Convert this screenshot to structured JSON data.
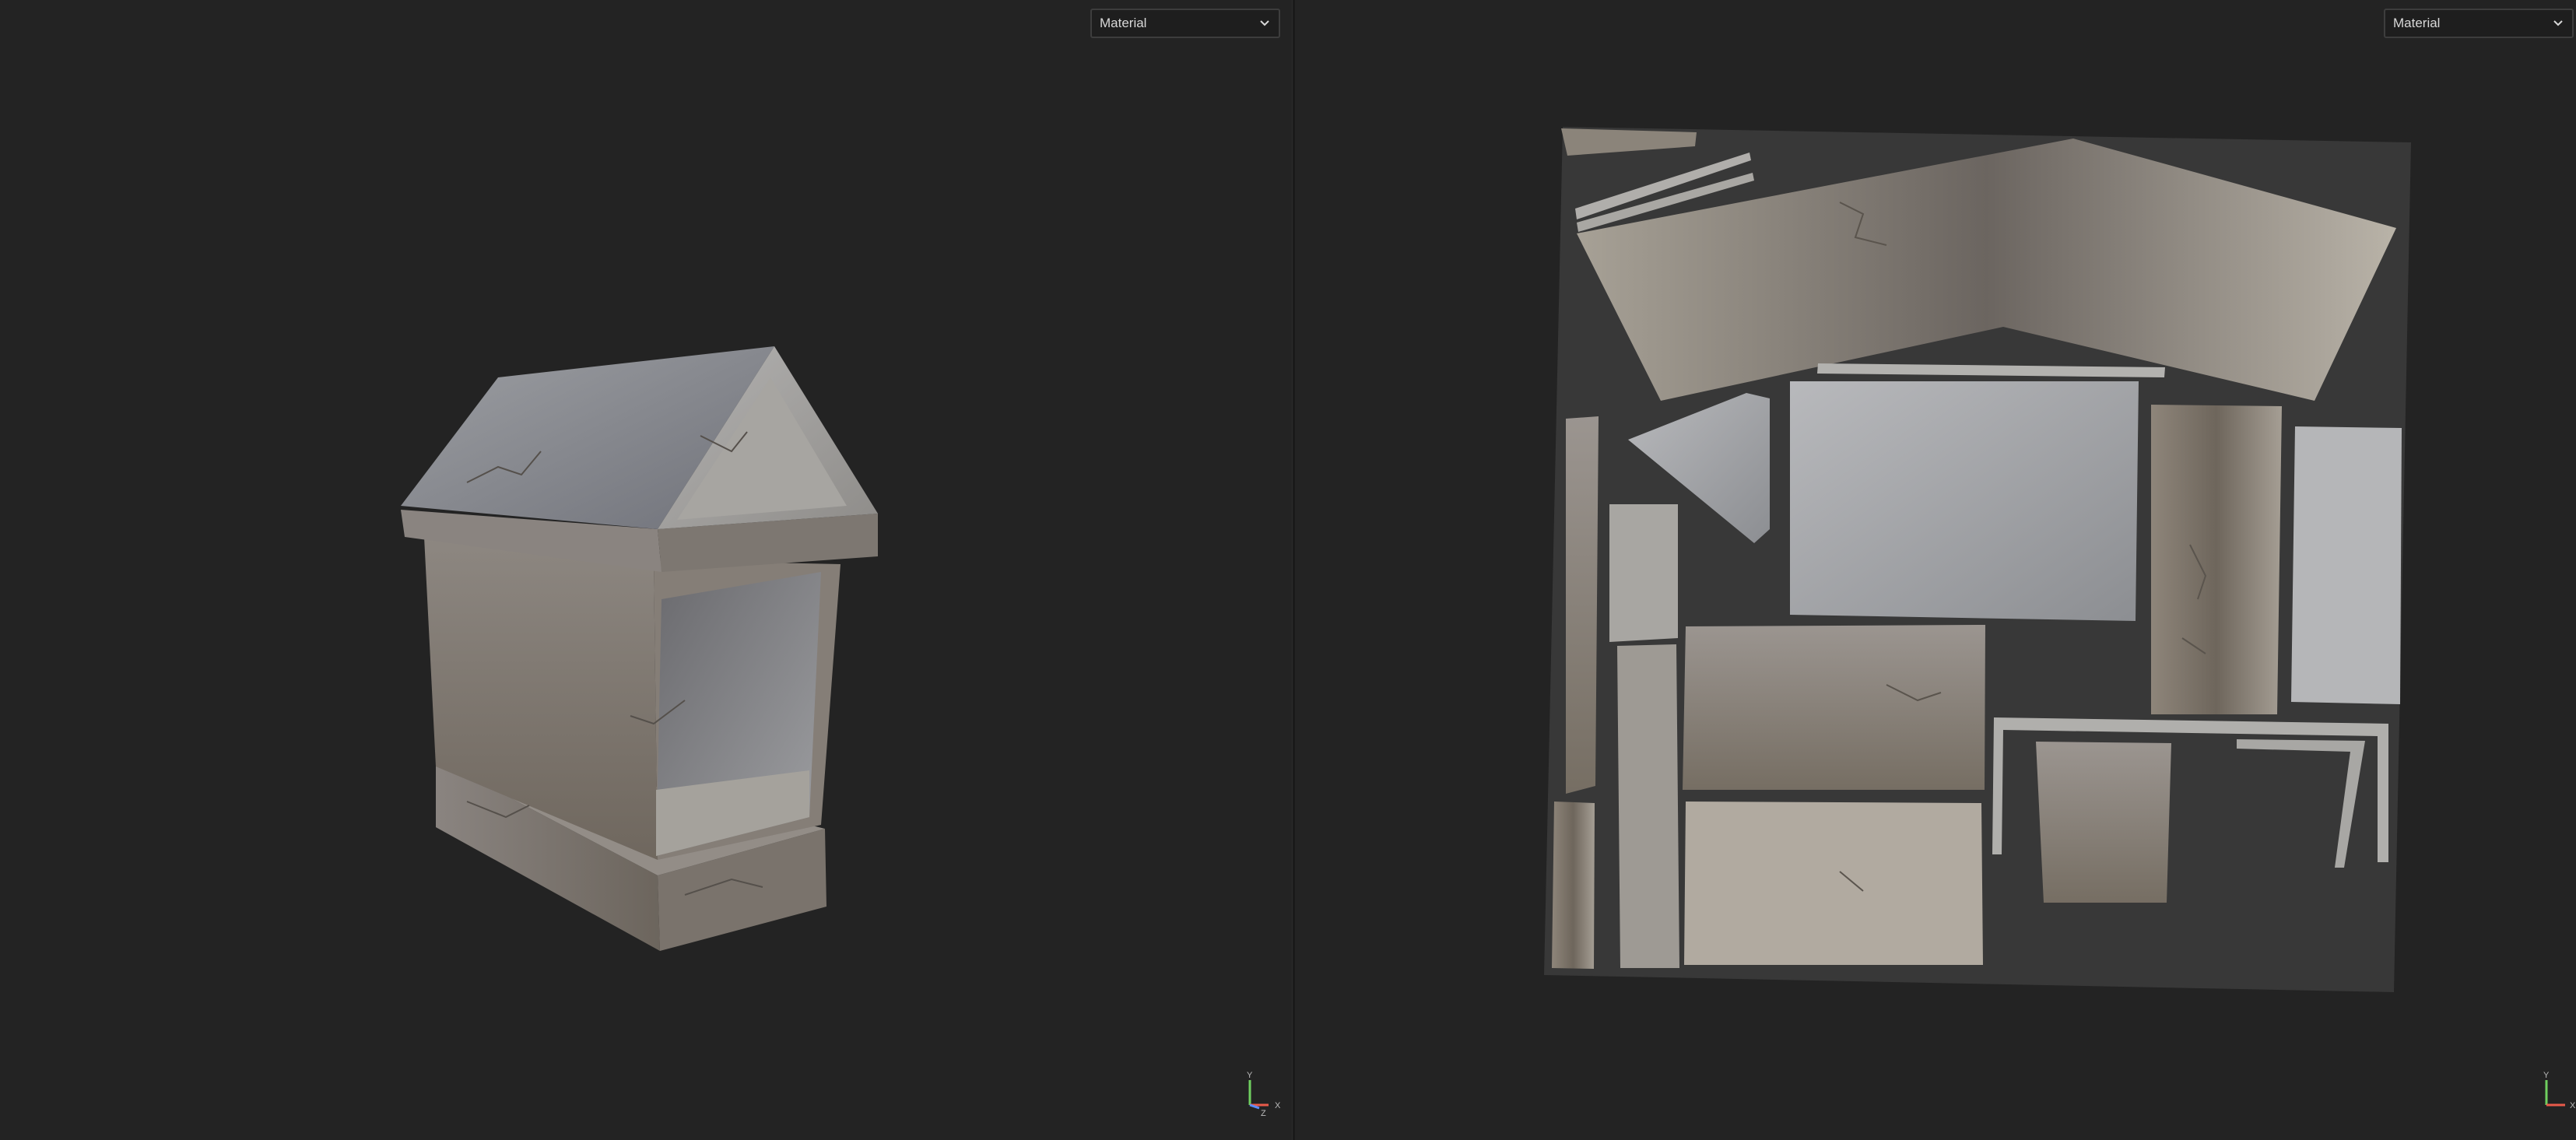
{
  "viewport_3d": {
    "channel_select": {
      "value": "Material",
      "icon": "chevron-down-icon"
    },
    "axis_gizmo": {
      "x_label": "X",
      "y_label": "Y",
      "z_label": "Z"
    }
  },
  "viewport_uv": {
    "channel_select": {
      "value": "Material",
      "icon": "chevron-down-icon"
    },
    "axis_gizmo": {
      "x_label": "X",
      "y_label": "Y"
    }
  },
  "colors": {
    "background": "#232323",
    "uv_tile_background": "#383838",
    "axis_x": "#e85a4a",
    "axis_y": "#6fcf5f",
    "axis_z": "#5a8cff"
  }
}
